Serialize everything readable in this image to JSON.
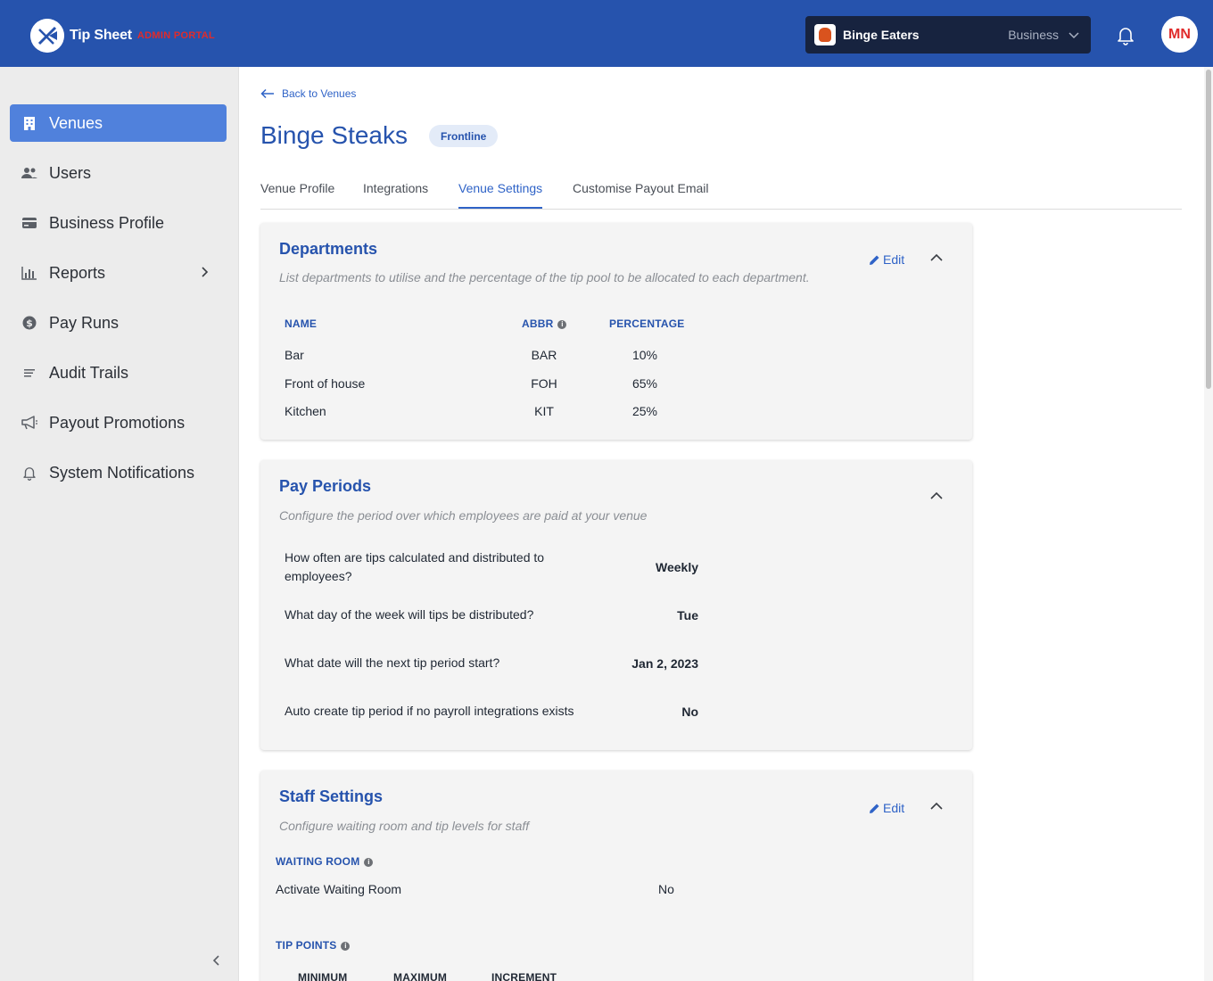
{
  "header": {
    "logo_text": "Tip Sheet",
    "logo_sub": "ADMIN PORTAL",
    "business_name": "Binge Eaters",
    "business_type": "Business",
    "avatar_initials": "MN"
  },
  "sidebar": {
    "items": [
      {
        "label": "Venues",
        "icon": "building-icon"
      },
      {
        "label": "Users",
        "icon": "users-icon"
      },
      {
        "label": "Business Profile",
        "icon": "card-icon"
      },
      {
        "label": "Reports",
        "icon": "bar-chart-icon"
      },
      {
        "label": "Pay Runs",
        "icon": "dollar-icon"
      },
      {
        "label": "Audit Trails",
        "icon": "list-icon"
      },
      {
        "label": "Payout Promotions",
        "icon": "megaphone-icon"
      },
      {
        "label": "System Notifications",
        "icon": "bell-icon"
      }
    ]
  },
  "main": {
    "back_label": "Back to Venues",
    "title": "Binge Steaks",
    "badge": "Frontline",
    "tabs": [
      "Venue Profile",
      "Integrations",
      "Venue Settings",
      "Customise Payout Email"
    ]
  },
  "departments": {
    "title": "Departments",
    "description": "List departments to utilise and the percentage of the tip pool to be allocated to each department.",
    "edit_label": "Edit",
    "columns": [
      "NAME",
      "ABBR",
      "PERCENTAGE"
    ],
    "rows": [
      {
        "name": "Bar",
        "abbr": "BAR",
        "percentage": "10%"
      },
      {
        "name": "Front of house",
        "abbr": "FOH",
        "percentage": "65%"
      },
      {
        "name": "Kitchen",
        "abbr": "KIT",
        "percentage": "25%"
      }
    ]
  },
  "pay_periods": {
    "title": "Pay Periods",
    "description": "Configure the period over which employees are paid at your venue",
    "items": [
      {
        "question": "How often are tips calculated and distributed to employees?",
        "answer": "Weekly"
      },
      {
        "question": "What day of the week will tips be distributed?",
        "answer": "Tue"
      },
      {
        "question": "What date will the next tip period start?",
        "answer": "Jan 2, 2023"
      },
      {
        "question": "Auto create tip period if no payroll integrations exists",
        "answer": "No"
      }
    ]
  },
  "staff_settings": {
    "title": "Staff Settings",
    "description": "Configure waiting room and tip levels for staff",
    "edit_label": "Edit",
    "waiting_room_heading": "WAITING ROOM",
    "waiting_room_label": "Activate Waiting Room",
    "waiting_room_value": "No",
    "tip_points_heading": "TIP POINTS",
    "tip_points_columns": [
      "MINIMUM",
      "MAXIMUM",
      "INCREMENT"
    ]
  },
  "colors": {
    "brand_blue": "#2653ad",
    "accent_blue": "#5081dc",
    "logo_red": "#e02b2b"
  }
}
